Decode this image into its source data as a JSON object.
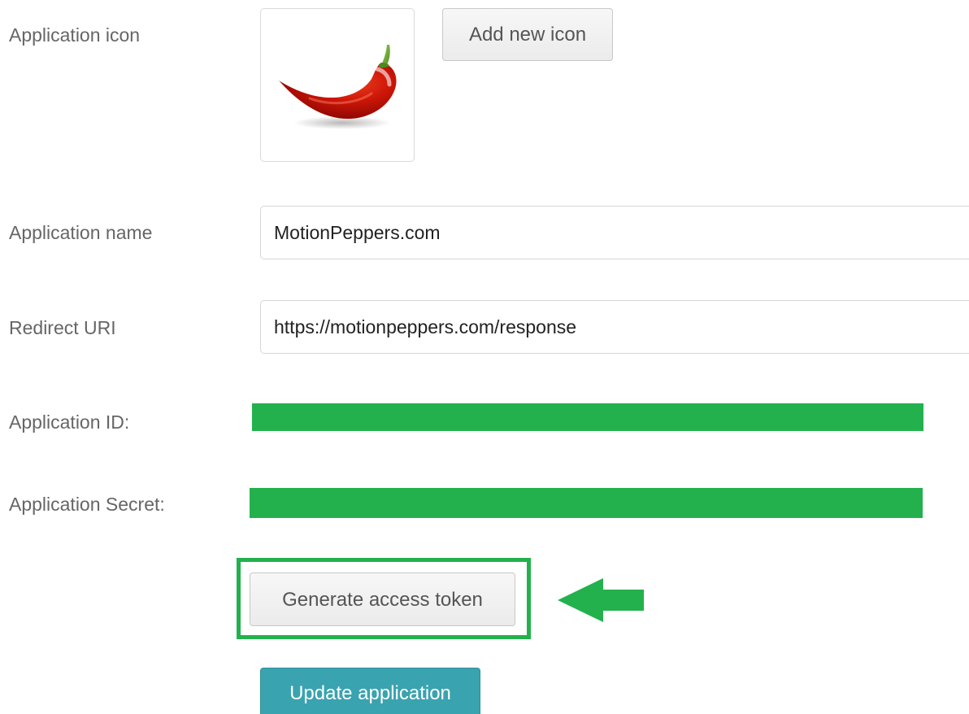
{
  "form": {
    "icon_label": "Application icon",
    "icon_image": "chili-pepper-icon",
    "add_icon_button": "Add new icon",
    "name_label": "Application name",
    "name_value": "MotionPeppers.com",
    "redirect_label": "Redirect URI",
    "redirect_value": "https://motionpeppers.com/response",
    "app_id_label": "Application ID:",
    "app_secret_label": "Application Secret:",
    "generate_button": "Generate access token",
    "update_button": "Update application"
  },
  "annotations": {
    "redaction_color": "#23b14d",
    "highlight_color": "#23b14d",
    "arrow_color": "#23b14d"
  },
  "colors": {
    "label_text": "#666666",
    "primary_button": "#3aa3b0"
  }
}
